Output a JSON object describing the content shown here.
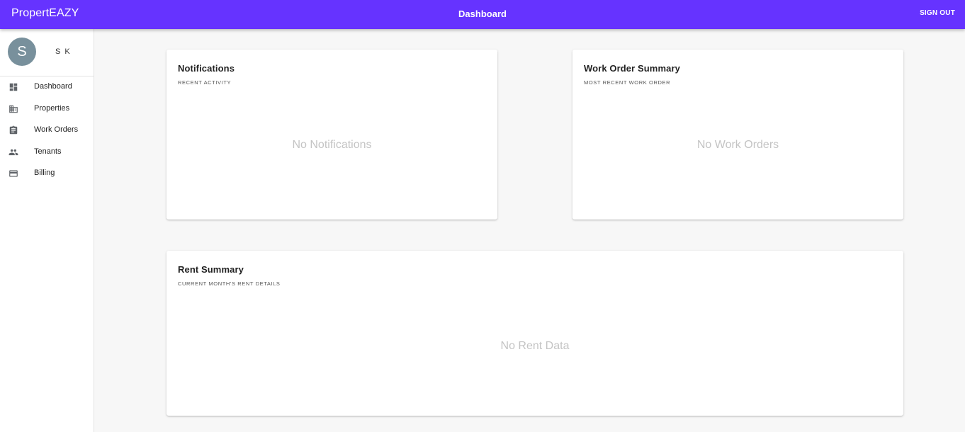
{
  "header": {
    "brand": "PropertEAZY",
    "title": "Dashboard",
    "sign_out_label": "SIGN OUT",
    "color": "#6633ff"
  },
  "sidebar": {
    "profile": {
      "avatar_initial": "S",
      "name": "S K"
    },
    "items": [
      {
        "label": "Dashboard",
        "icon": "dashboard-icon"
      },
      {
        "label": "Properties",
        "icon": "building-icon"
      },
      {
        "label": "Work Orders",
        "icon": "clipboard-icon"
      },
      {
        "label": "Tenants",
        "icon": "people-icon"
      },
      {
        "label": "Billing",
        "icon": "credit-card-icon"
      }
    ]
  },
  "cards": {
    "notifications": {
      "title": "Notifications",
      "subtitle": "RECENT ACTIVITY",
      "empty_text": "No Notifications"
    },
    "work_orders": {
      "title": "Work Order Summary",
      "subtitle": "MOST RECENT WORK ORDER",
      "empty_text": "No Work Orders"
    },
    "rent": {
      "title": "Rent Summary",
      "subtitle": "CURRENT MONTH'S RENT DETAILS",
      "empty_text": "No Rent Data"
    }
  }
}
